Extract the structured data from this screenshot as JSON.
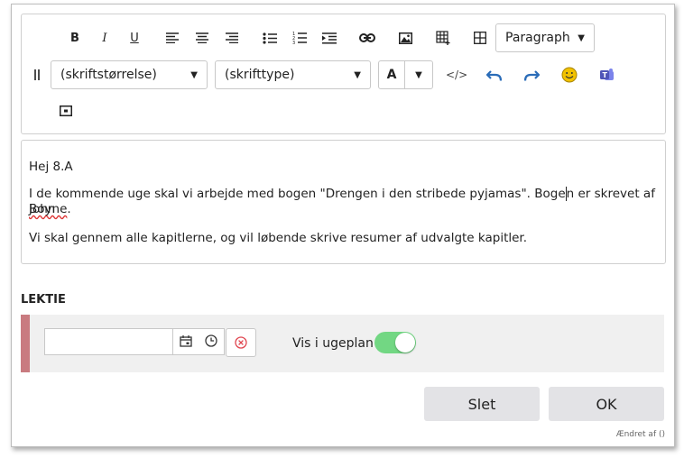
{
  "toolbar": {
    "bold_label": "B",
    "italic_label": "I",
    "underline_label": "U",
    "font_color_label": "A",
    "paragraph_select": "Paragraph",
    "font_size_select": "(skriftstørrelse)",
    "font_family_select": "(skrifttype)",
    "code_label": "</>",
    "icons": [
      "align-left-icon",
      "align-center-icon",
      "align-right-icon",
      "bullet-list-icon",
      "numbered-list-icon",
      "indent-icon",
      "link-icon",
      "image-icon",
      "table-insert-icon",
      "table-icon",
      "drag-handle-icon",
      "source-code-icon",
      "undo-icon",
      "redo-icon",
      "emoji-icon",
      "teams-icon",
      "embed-icon"
    ]
  },
  "editor": {
    "line1": "Hej 8.A",
    "line2a": "I de kommende uge skal vi arbejde med bogen \"Drengen i den stribede pyjamas\". Boge",
    "line2b": "n er skrevet af John",
    "line3_word": "Boyne",
    "line3_rest": ".",
    "line4": "Vi skal gennem alle kapitlerne, og vil løbende skrive resumer af udvalgte kapitler."
  },
  "lektie": {
    "title": "LEKTIE",
    "date_value": "",
    "vis_label": "Vis i ugeplan",
    "vis_enabled": true
  },
  "buttons": {
    "delete_label": "Slet",
    "ok_label": "OK"
  },
  "footer": {
    "changed_by": "Ændret af ()"
  },
  "colors": {
    "toggle_on": "#72d783",
    "lektie_bar": "#c97b80",
    "button_bg": "#e3e3e6",
    "clear_icon": "#e0454f",
    "undo_redo": "#2b6cb8",
    "emoji": "#f2c200",
    "teams": "#4f55b8"
  }
}
